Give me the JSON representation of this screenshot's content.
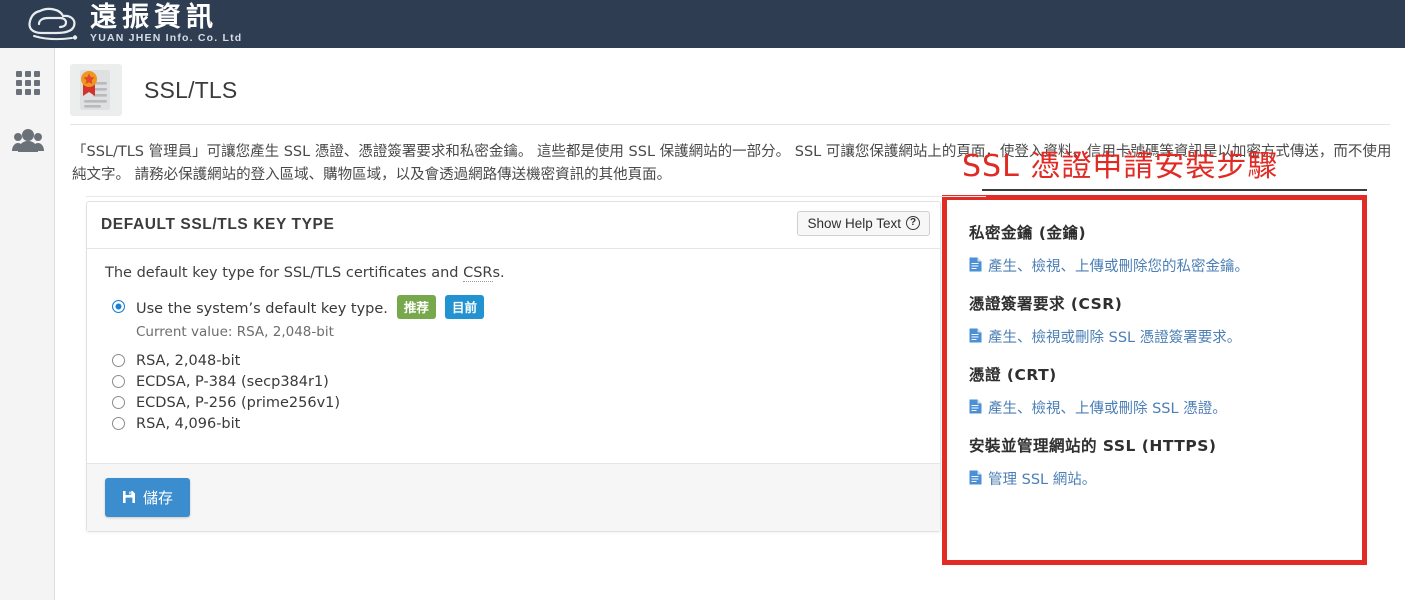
{
  "topbar": {
    "brand_cn": "遠振資訊",
    "brand_en": "YUAN JHEN Info. Co. Ltd",
    "logo_icon": "cloud-logo-icon"
  },
  "sidebar": {
    "items": [
      {
        "name": "apps-grid",
        "icon": "grid-icon",
        "label": ""
      },
      {
        "name": "users",
        "icon": "users-icon",
        "label": ""
      }
    ]
  },
  "page": {
    "icon": "ssl-certificate-icon",
    "title": "SSL/TLS",
    "intro": "「SSL/TLS 管理員」可讓您產生 SSL 憑證、憑證簽署要求和私密金鑰。 這些都是使用 SSL 保護網站的一部分。 SSL 可讓您保護網站上的頁面，使登入資料、信用卡號碼等資訊是以加密方式傳送，而不使用純文字。 請務必保護網站的登入區域、購物區域，以及會透過網路傳送機密資訊的其他頁面。"
  },
  "card": {
    "header_title": "DEFAULT SSL/TLS KEY TYPE",
    "help_button": "Show Help Text",
    "help_icon": "question-circle-icon",
    "lead_before": "The default key type for SSL/TLS certificates and ",
    "lead_dotted": "CSR",
    "lead_after": "s.",
    "default_option": {
      "label": "Use the system’s default key type.",
      "badge_recommended": "推荐",
      "badge_current": "目前",
      "current_value": "Current value: RSA, 2,048-bit",
      "selected": true
    },
    "options": [
      {
        "label": "RSA, 2,048-bit",
        "selected": false
      },
      {
        "label": "ECDSA, P-384 (secp384r1)",
        "selected": false
      },
      {
        "label": "ECDSA, P-256 (prime256v1)",
        "selected": false
      },
      {
        "label": "RSA, 4,096-bit",
        "selected": false
      }
    ],
    "save_label": "儲存",
    "save_icon": "floppy-save-icon"
  },
  "right_panel": {
    "title": "SSL 憑證申請安裝步驟",
    "title_color": "#e02a23",
    "border_color": "#e12b24",
    "sections": [
      {
        "heading": "私密金鑰 (金鑰)",
        "link": "產生、檢視、上傳或刪除您的私密金鑰。",
        "link_icon": "document-icon"
      },
      {
        "heading": "憑證簽署要求 (CSR)",
        "link": "產生、檢視或刪除 SSL 憑證簽署要求。",
        "link_icon": "document-icon"
      },
      {
        "heading": "憑證 (CRT)",
        "link": "產生、檢視、上傳或刪除 SSL 憑證。",
        "link_icon": "document-icon"
      },
      {
        "heading": "安裝並管理網站的 SSL (HTTPS)",
        "link": "管理 SSL 網站。",
        "link_icon": "document-icon"
      }
    ]
  }
}
